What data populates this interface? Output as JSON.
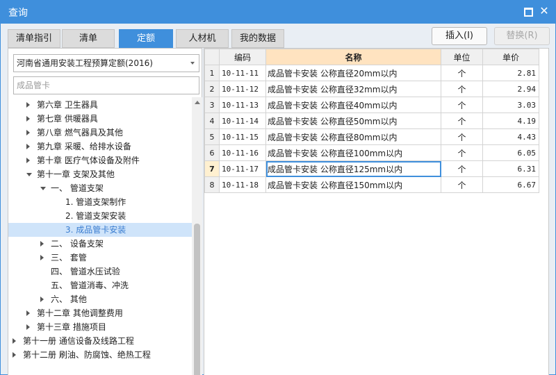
{
  "window": {
    "title": "查询"
  },
  "tabs": [
    {
      "label": "清单指引",
      "active": false
    },
    {
      "label": "清单",
      "active": false
    },
    {
      "label": "定额",
      "active": true
    },
    {
      "label": "人材机",
      "active": false
    },
    {
      "label": "我的数据",
      "active": false
    }
  ],
  "toolbar": {
    "insert_label": "插入(I)",
    "replace_label": "替换(R)"
  },
  "left": {
    "dropdown_value": "河南省通用安装工程预算定额(2016)",
    "search_value": "成品管卡"
  },
  "tree": [
    {
      "label": "第六章 卫生器具",
      "expander": "closed",
      "selected": false
    },
    {
      "label": "第七章 供暖器具",
      "expander": "closed",
      "selected": false
    },
    {
      "label": "第八章 燃气器具及其他",
      "expander": "closed",
      "selected": false
    },
    {
      "label": "第九章 采暖、给排水设备",
      "expander": "closed",
      "selected": false
    },
    {
      "label": "第十章 医疗气体设备及附件",
      "expander": "closed",
      "selected": false
    },
    {
      "label": "第十一章 支架及其他",
      "expander": "open",
      "selected": false
    },
    {
      "label": "一、 管道支架",
      "expander": "open",
      "selected": false
    },
    {
      "label": "1. 管道支架制作",
      "expander": "none",
      "selected": false
    },
    {
      "label": "2. 管道支架安装",
      "expander": "none",
      "selected": false
    },
    {
      "label": "3. 成品管卡安装",
      "expander": "none",
      "selected": true
    },
    {
      "label": "二、 设备支架",
      "expander": "closed",
      "selected": false
    },
    {
      "label": "三、 套管",
      "expander": "closed",
      "selected": false
    },
    {
      "label": "四、 管道水压试验",
      "expander": "none",
      "selected": false
    },
    {
      "label": "五、 管道消毒、冲洗",
      "expander": "none",
      "selected": false
    },
    {
      "label": "六、 其他",
      "expander": "closed",
      "selected": false
    },
    {
      "label": "第十二章 其他调整费用",
      "expander": "closed",
      "selected": false
    },
    {
      "label": "第十三章 措施项目",
      "expander": "closed",
      "selected": false
    },
    {
      "label": "第十一册 通信设备及线路工程",
      "expander": "closed",
      "selected": false
    },
    {
      "label": "第十二册 刷油、防腐蚀、绝热工程",
      "expander": "closed",
      "selected": false
    }
  ],
  "table": {
    "headers": {
      "code": "编码",
      "name": "名称",
      "unit": "单位",
      "price": "单价"
    },
    "rows": [
      {
        "no": "1",
        "code": "10-11-11",
        "name": "成品管卡安装 公称直径20mm以内",
        "unit": "个",
        "price": "2.81"
      },
      {
        "no": "2",
        "code": "10-11-12",
        "name": "成品管卡安装 公称直径32mm以内",
        "unit": "个",
        "price": "2.94"
      },
      {
        "no": "3",
        "code": "10-11-13",
        "name": "成品管卡安装 公称直径40mm以内",
        "unit": "个",
        "price": "3.03"
      },
      {
        "no": "4",
        "code": "10-11-14",
        "name": "成品管卡安装 公称直径50mm以内",
        "unit": "个",
        "price": "4.19"
      },
      {
        "no": "5",
        "code": "10-11-15",
        "name": "成品管卡安装 公称直径80mm以内",
        "unit": "个",
        "price": "4.43"
      },
      {
        "no": "6",
        "code": "10-11-16",
        "name": "成品管卡安装 公称直径100mm以内",
        "unit": "个",
        "price": "6.05"
      },
      {
        "no": "7",
        "code": "10-11-17",
        "name": "成品管卡安装 公称直径125mm以内",
        "unit": "个",
        "price": "6.31"
      },
      {
        "no": "8",
        "code": "10-11-18",
        "name": "成品管卡安装 公称直径150mm以内",
        "unit": "个",
        "price": "6.67"
      }
    ],
    "current_row": 7
  },
  "colors": {
    "accent": "#3f8fdc",
    "selected_row": "#cfe4fa",
    "name_header": "#ffe3c0"
  },
  "icons": {
    "maximize": "maximize-icon",
    "close": "close-icon",
    "dropdown": "chevron-down-icon"
  }
}
